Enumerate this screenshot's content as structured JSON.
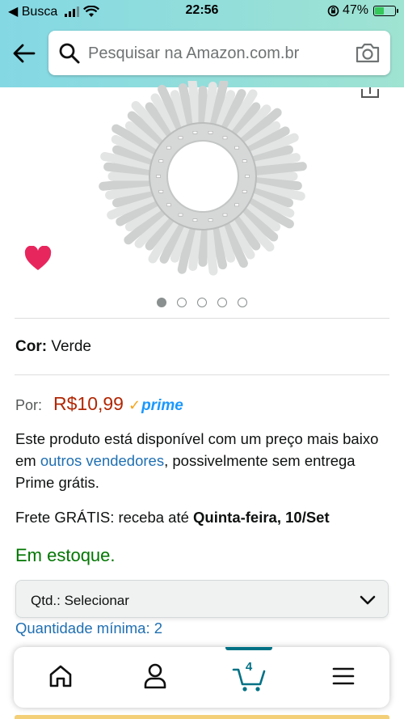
{
  "status_bar": {
    "back_app": "◀ Busca",
    "time": "22:56",
    "battery_percent": "47%",
    "battery_level": 0.47
  },
  "search": {
    "placeholder": "Pesquisar na Amazon.com.br"
  },
  "gallery": {
    "image_count": 5,
    "active_index": 0
  },
  "product": {
    "color_label": "Cor:",
    "color_value": "Verde",
    "price_label": "Por:",
    "price": "R$10,99",
    "prime_label": "prime",
    "availability_before": "Este produto está disponível com um preço mais baixo em ",
    "availability_link": "outros vendedores",
    "availability_after": ", possivelmente sem entrega Prime grátis.",
    "freight_prefix": "Frete GRÁTIS: receba até ",
    "freight_date": "Quinta-feira, 10/Set",
    "stock": "Em estoque.",
    "qty_label": "Qtd.:  Selecionar",
    "min_qty": "Quantidade mínima: 2"
  },
  "bottom_nav": {
    "cart_count": "4",
    "items": [
      "home",
      "account",
      "cart",
      "menu"
    ]
  },
  "colors": {
    "price": "#b12704",
    "stock": "#007600",
    "link": "#1f6fb2",
    "prime": "#1a98ff",
    "heart": "#e8265e",
    "header_gradient_start": "#84d8e4",
    "header_gradient_end": "#9fe3d2"
  }
}
